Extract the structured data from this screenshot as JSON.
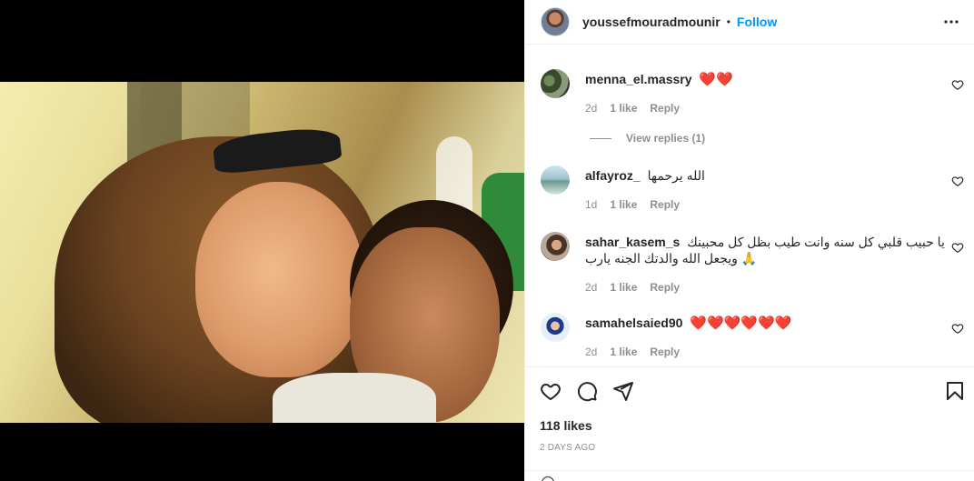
{
  "post": {
    "username": "youssefmouradmounir",
    "separator": "•",
    "follow_label": "Follow",
    "likes": "118 likes",
    "time_ago": "2 days ago"
  },
  "comments": [
    {
      "username": "menna_el.massry",
      "text": "❤️❤️",
      "time": "2d",
      "likes": "1 like",
      "reply_label": "Reply",
      "view_replies": "View replies (1)"
    },
    {
      "username": "alfayroz_",
      "text": "الله يرحمها",
      "time": "1d",
      "likes": "1 like",
      "reply_label": "Reply"
    },
    {
      "username": "sahar_kasem_s",
      "text": "يا حبيب قلبي كل سنه وانت طيب بظل كل محبينك ويجعل الله والدتك الجنه يارب 🙏",
      "time": "2d",
      "likes": "1 like",
      "reply_label": "Reply"
    },
    {
      "username": "samahelsaied90",
      "text": "❤️❤️❤️❤️❤️❤️",
      "time": "2d",
      "likes": "1 like",
      "reply_label": "Reply"
    }
  ],
  "icons": {
    "header_more": "more-options-icon",
    "like": "heart-icon",
    "comment": "comment-icon",
    "share": "share-icon",
    "save": "bookmark-icon"
  },
  "colors": {
    "accent": "#0095f6",
    "text": "#262626",
    "muted": "#8e8e8e",
    "heart": "#ed1c24"
  }
}
